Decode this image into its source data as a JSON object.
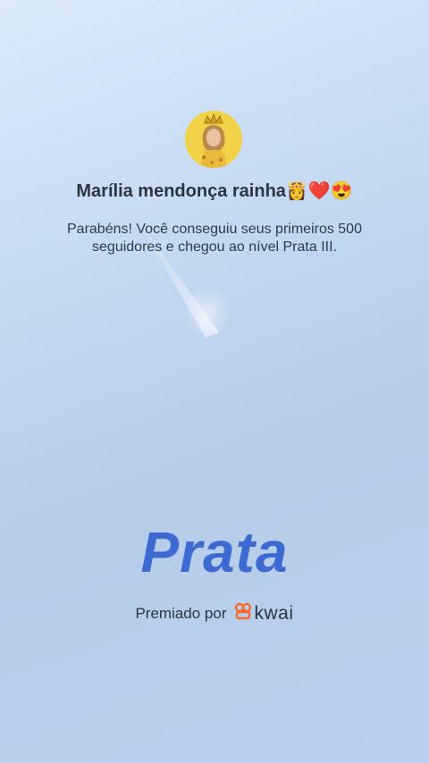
{
  "header": {
    "title": "Marília mendonça rainha👸❤️😍"
  },
  "congrats": {
    "message": "Parabéns! Você conseguiu seus primeiros 500 seguidores e chegou ao nível Prata III."
  },
  "level": {
    "name": "Prata"
  },
  "footer": {
    "awarded_by": "Premiado por",
    "brand_name": "kwai",
    "brand_icon": "kwai-logo-icon"
  },
  "colors": {
    "level_text": "#3d6ad0",
    "brand_orange": "#ff6a2b",
    "avatar_bg": "#f2d247"
  }
}
